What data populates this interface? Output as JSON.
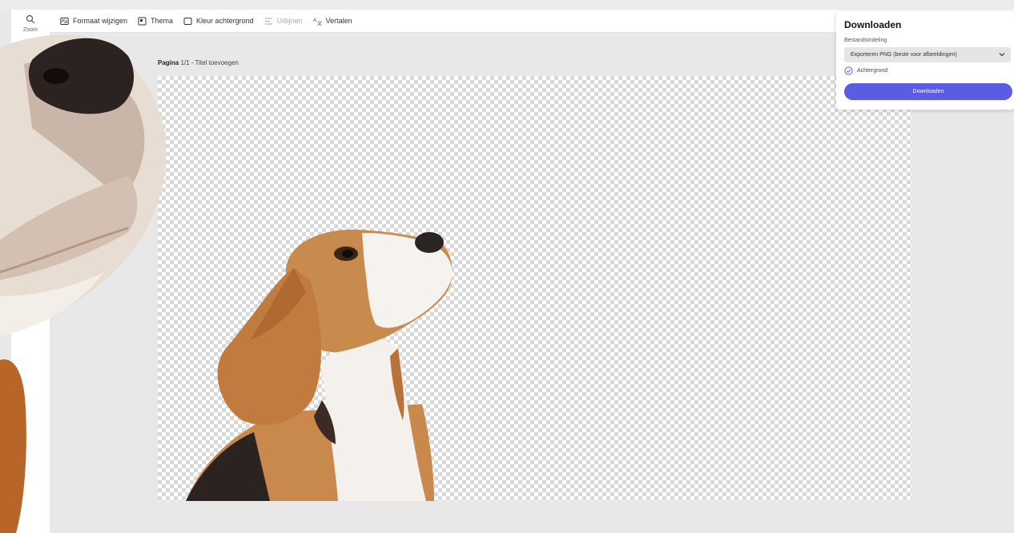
{
  "rail": {
    "zoom_label": "Zoom"
  },
  "toolbar": {
    "items": [
      {
        "label": "Formaat wijzigen",
        "icon": "resize-icon",
        "disabled": false
      },
      {
        "label": "Thema",
        "icon": "theme-icon",
        "disabled": false
      },
      {
        "label": "Kleur achtergrond",
        "icon": "background-color-icon",
        "disabled": false
      },
      {
        "label": "Uitlijnen",
        "icon": "align-icon",
        "disabled": true
      },
      {
        "label": "Vertalen",
        "icon": "translate-icon",
        "disabled": false
      }
    ]
  },
  "page": {
    "prefix": "Pagina",
    "label": "1/1 - Titel toevoegen"
  },
  "download_panel": {
    "title": "Downloaden",
    "format_label": "Bestandsindeling",
    "format_value": "Exporteren PNG (beste voor afbeeldingen)",
    "checkbox_label": "Achtergrond",
    "checkbox_checked": true,
    "button_label": "Downloaden"
  },
  "colors": {
    "accent": "#5b5ce2",
    "canvas_bg": "#e8e8e8"
  }
}
